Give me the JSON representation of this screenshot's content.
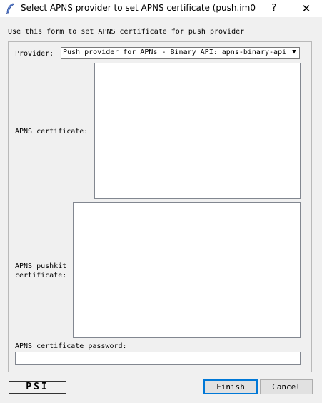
{
  "window": {
    "title": "Select APNS provider to set APNS certificate (push.im0…",
    "help_glyph": "?",
    "close_glyph": "✕",
    "icon": "feather-pen-icon"
  },
  "form": {
    "intro": "Use this form to set APNS certificate for push provider",
    "provider_label": "Provider:",
    "provider_value": "Push provider for APNs - Binary API: apns-binary-api",
    "certificate_label": "APNS certificate:",
    "certificate_value": "",
    "pushkit_label_line1": "APNS pushkit",
    "pushkit_label_line2": "certificate:",
    "pushkit_value": "",
    "password_label": "APNS certificate password:",
    "password_value": ""
  },
  "footer": {
    "badge_text": "PSI",
    "finish_label": "Finish",
    "cancel_label": "Cancel"
  },
  "colors": {
    "window_bg": "#f0f0f0",
    "focus_accent": "#0078d7"
  }
}
